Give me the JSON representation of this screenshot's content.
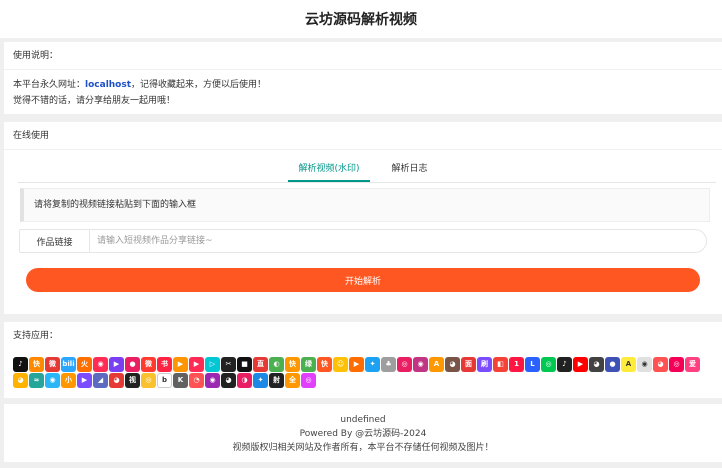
{
  "header": {
    "title": "云坊源码解析视频"
  },
  "usage": {
    "title": "使用说明：",
    "line1_prefix": "本平台永久网址：",
    "line1_link": "localhost",
    "line1_suffix": "，记得收藏起来，方便以后使用！",
    "line2": "觉得不错的话，请分享给朋友一起用哦！"
  },
  "online": {
    "title": "在线使用",
    "tabs": [
      {
        "label": "解析视频(水印)"
      },
      {
        "label": "解析日志"
      }
    ],
    "notice": "请将复制的视频链接粘贴到下面的输入框",
    "input_label": "作品链接",
    "input_placeholder": "请输入短视频作品分享链接~",
    "submit_label": "开始解析"
  },
  "support": {
    "title": "支持应用：",
    "apps": [
      {
        "color": "#111111",
        "glyph": "♪"
      },
      {
        "color": "#ff8a00",
        "glyph": "快"
      },
      {
        "color": "#e53935",
        "glyph": "微"
      },
      {
        "color": "#2aa6ff",
        "glyph": "bili"
      },
      {
        "color": "#ff6f00",
        "glyph": "火"
      },
      {
        "color": "#ff2d55",
        "glyph": "◉"
      },
      {
        "color": "#7b3ff2",
        "glyph": "▶"
      },
      {
        "color": "#e91e63",
        "glyph": "●"
      },
      {
        "color": "#ff3b30",
        "glyph": "微"
      },
      {
        "color": "#ff2442",
        "glyph": "书"
      },
      {
        "color": "#ff9500",
        "glyph": "▶"
      },
      {
        "color": "#fe2c55",
        "glyph": "▶"
      },
      {
        "color": "#00c7d4",
        "glyph": "▷"
      },
      {
        "color": "#222222",
        "glyph": "✂"
      },
      {
        "color": "#111111",
        "glyph": "■"
      },
      {
        "color": "#e53935",
        "glyph": "直"
      },
      {
        "color": "#4caf50",
        "glyph": "◐"
      },
      {
        "color": "#ff9800",
        "glyph": "快"
      },
      {
        "color": "#4caf50",
        "glyph": "绿"
      },
      {
        "color": "#ff5722",
        "glyph": "快"
      },
      {
        "color": "#ffc107",
        "glyph": "☺"
      },
      {
        "color": "#ff6d00",
        "glyph": "▶"
      },
      {
        "color": "#1da1f2",
        "glyph": "✦"
      },
      {
        "color": "#9e9e9e",
        "glyph": "♣"
      },
      {
        "color": "#e91e63",
        "glyph": "◎"
      },
      {
        "color": "#c13584",
        "glyph": "◉"
      },
      {
        "color": "#ff9800",
        "glyph": "A"
      },
      {
        "color": "#795548",
        "glyph": "◕"
      },
      {
        "color": "#e53935",
        "glyph": "面"
      },
      {
        "color": "#7c4dff",
        "glyph": "刷"
      },
      {
        "color": "#f44336",
        "glyph": "◧"
      },
      {
        "color": "#ff1744",
        "glyph": "1"
      },
      {
        "color": "#2962ff",
        "glyph": "L"
      },
      {
        "color": "#00c853",
        "glyph": "◎"
      },
      {
        "color": "#212121",
        "glyph": "♪"
      },
      {
        "color": "#ff0000",
        "glyph": "▶"
      },
      {
        "color": "#424242",
        "glyph": "◕"
      },
      {
        "color": "#3f51b5",
        "glyph": "●"
      },
      {
        "color": "#ffeb3b",
        "glyph": "A"
      },
      {
        "color": "#e0e0e0",
        "glyph": "◉"
      },
      {
        "color": "#ff5252",
        "glyph": "◕"
      },
      {
        "color": "#f50057",
        "glyph": "◎"
      },
      {
        "color": "#ff4081",
        "glyph": "爱"
      },
      {
        "color": "#ffb300",
        "glyph": "◕"
      },
      {
        "color": "#26a69a",
        "glyph": "≈"
      },
      {
        "color": "#29b6f6",
        "glyph": "◉"
      },
      {
        "color": "#ff9800",
        "glyph": "小"
      },
      {
        "color": "#7c4dff",
        "glyph": "▶"
      },
      {
        "color": "#5c6bc0",
        "glyph": "◢"
      },
      {
        "color": "#e53935",
        "glyph": "◕"
      },
      {
        "color": "#212121",
        "glyph": "视"
      },
      {
        "color": "#fbc02d",
        "glyph": "◎"
      },
      {
        "color": "#ffffff",
        "glyph": "b"
      },
      {
        "color": "#616161",
        "glyph": "K"
      },
      {
        "color": "#ff5252",
        "glyph": "◔"
      },
      {
        "color": "#9c27b0",
        "glyph": "◉"
      },
      {
        "color": "#212121",
        "glyph": "◕"
      },
      {
        "color": "#e91e63",
        "glyph": "◑"
      },
      {
        "color": "#1e88e5",
        "glyph": "✦"
      },
      {
        "color": "#212121",
        "glyph": "射"
      },
      {
        "color": "#ff9800",
        "glyph": "全"
      },
      {
        "color": "#e040fb",
        "glyph": "◎"
      }
    ]
  },
  "footer": {
    "line1": "undefined",
    "line2": "Powered By @云坊源码-2024",
    "line3": "视频版权归相关网站及作者所有，本平台不存储任何视频及图片！"
  }
}
